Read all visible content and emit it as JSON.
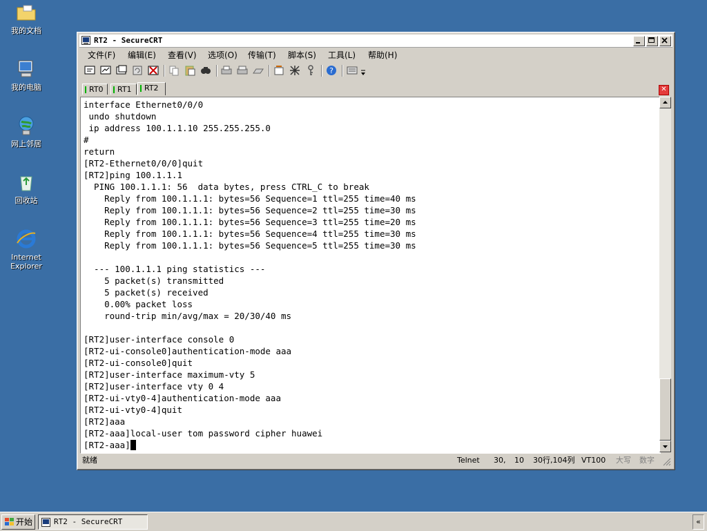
{
  "desktop": {
    "icons": [
      {
        "label": "我的文档"
      },
      {
        "label": "我的电脑"
      },
      {
        "label": "网上邻居"
      },
      {
        "label": "回收站"
      },
      {
        "label_line1": "Internet",
        "label_line2": "Explorer"
      }
    ]
  },
  "window": {
    "title": "RT2 - SecureCRT",
    "menus": [
      "文件(F)",
      "编辑(E)",
      "查看(V)",
      "选项(O)",
      "传输(T)",
      "脚本(S)",
      "工具(L)",
      "帮助(H)"
    ],
    "tabs": [
      "RT0",
      "RT1",
      "RT2"
    ],
    "active_tab": "RT2"
  },
  "terminal": {
    "lines": [
      "interface Ethernet0/0/0",
      " undo shutdown",
      " ip address 100.1.1.10 255.255.255.0",
      "#",
      "return",
      "[RT2-Ethernet0/0/0]quit",
      "[RT2]ping 100.1.1.1",
      "  PING 100.1.1.1: 56  data bytes, press CTRL_C to break",
      "    Reply from 100.1.1.1: bytes=56 Sequence=1 ttl=255 time=40 ms",
      "    Reply from 100.1.1.1: bytes=56 Sequence=2 ttl=255 time=30 ms",
      "    Reply from 100.1.1.1: bytes=56 Sequence=3 ttl=255 time=20 ms",
      "    Reply from 100.1.1.1: bytes=56 Sequence=4 ttl=255 time=30 ms",
      "    Reply from 100.1.1.1: bytes=56 Sequence=5 ttl=255 time=30 ms",
      "",
      "  --- 100.1.1.1 ping statistics ---",
      "    5 packet(s) transmitted",
      "    5 packet(s) received",
      "    0.00% packet loss",
      "    round-trip min/avg/max = 20/30/40 ms",
      "",
      "[RT2]user-interface console 0",
      "[RT2-ui-console0]authentication-mode aaa",
      "[RT2-ui-console0]quit",
      "[RT2]user-interface maximum-vty 5",
      "[RT2]user-interface vty 0 4",
      "[RT2-ui-vty0-4]authentication-mode aaa",
      "[RT2-ui-vty0-4]quit",
      "[RT2]aaa",
      "[RT2-aaa]local-user tom password cipher huawei"
    ],
    "prompt": "[RT2-aaa]"
  },
  "statusbar": {
    "ready": "就绪",
    "protocol": "Telnet",
    "row": "30,",
    "col": "10",
    "size": "30行,104列",
    "emulation": "VT100",
    "caps": "大写",
    "num": "数字"
  },
  "taskbar": {
    "start_label": "开始",
    "task_title": "RT2 - SecureCRT",
    "tray_chevron": "«"
  },
  "colors": {
    "desktop": "#3a6ea5",
    "tab_indicator": "#00b000",
    "close_tab": "#e43b3b"
  }
}
